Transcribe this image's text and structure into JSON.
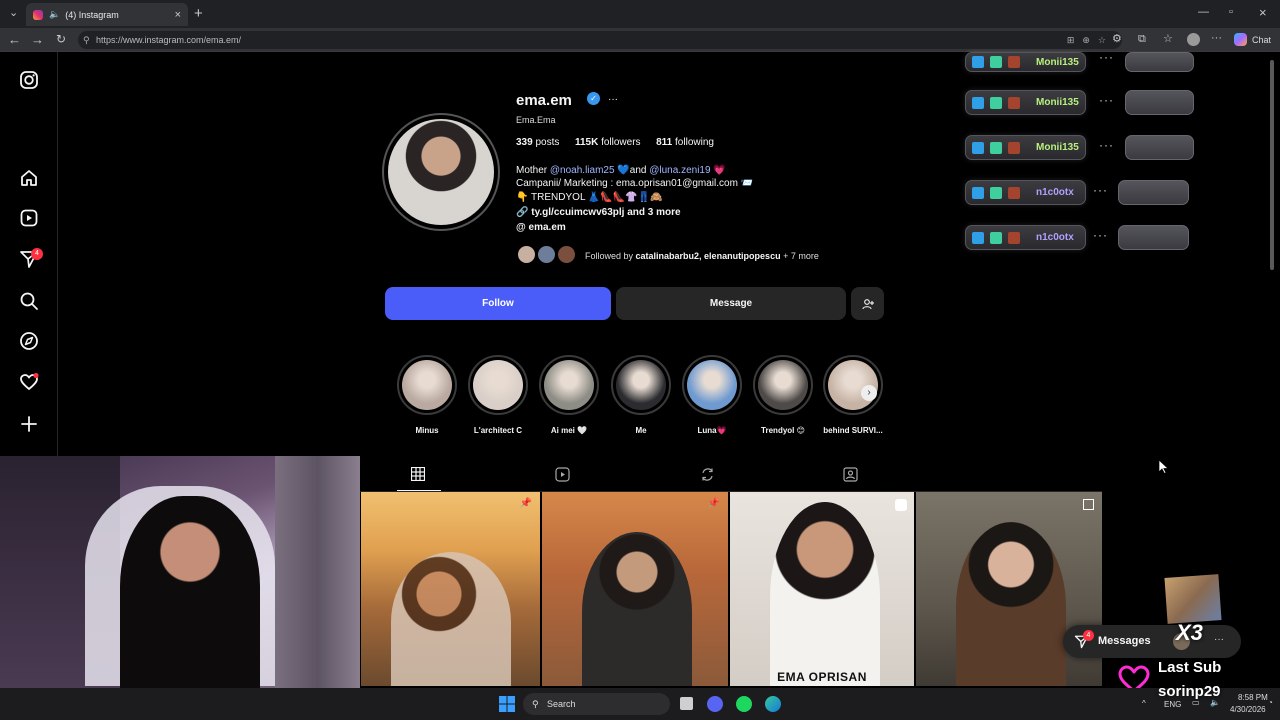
{
  "browser": {
    "tab_title": "(4) Instagram",
    "url": "https://www.instagram.com/ema.em/",
    "chat_label": "Chat"
  },
  "sidebar": {
    "notifications_badge": "4",
    "items": [
      "instagram-logo-icon",
      "home-icon",
      "reels-icon",
      "messages-icon",
      "search-icon",
      "explore-icon",
      "notifications-icon",
      "create-icon"
    ]
  },
  "profile": {
    "username": "ema.em",
    "more": "···",
    "full_name": "Ema.Ema",
    "posts_count": "339",
    "posts_label": "posts",
    "followers_count": "115K",
    "followers_label": "followers",
    "following_count": "811",
    "following_label": "following",
    "bio_line1_prefix": "Mother ",
    "bio_mention1": "@noah.liam25",
    "bio_and": " 💙and ",
    "bio_mention2": "@luna.zeni19",
    "bio_heart": " 💗",
    "bio_line2": "Campanii/ Marketing : ema.oprisan01@gmail.com 📨",
    "bio_line3": "👇 TRENDYOL 👗👠👠👚👖🙈",
    "link": "ty.gl/ccuimcwv63plj and 3 more",
    "threads": "ema.em",
    "followed_by_prefix": "Followed by ",
    "followed_by_names": "catalinabarbu2, elenanutipopescu",
    "followed_by_more": " + 7 more"
  },
  "actions": {
    "follow": "Follow",
    "message": "Message"
  },
  "highlights": [
    {
      "label": "Minus",
      "color": "#b9a9a0"
    },
    {
      "label": "L'architect C",
      "color": "#d9cfc8"
    },
    {
      "label": "Ai mei 🤍",
      "color": "#8d8d86"
    },
    {
      "label": "Me",
      "color": "#2c2c30"
    },
    {
      "label": "Luna💗",
      "color": "#6f9ad0"
    },
    {
      "label": "Trendyol 😊",
      "color": "#4e4a48"
    },
    {
      "label": "behind SURVI...",
      "color": "#c6b3a5"
    }
  ],
  "posts": [
    {
      "caption": "",
      "pinned": true
    },
    {
      "caption": "",
      "pinned": true
    },
    {
      "caption": "EMA OPRISAN",
      "pinned": false
    },
    {
      "caption": "",
      "pinned": false
    }
  ],
  "overlay": {
    "sub_names": [
      "Monii135",
      "Monii135",
      "Monii135",
      "n1c0otx",
      "n1c0otx"
    ],
    "messages_badge": "4",
    "messages_label": "Messages",
    "multiplier": "X3",
    "last_sub_label": "Last Sub",
    "last_sub_name": "sorinp29"
  },
  "taskbar": {
    "search_label": "Search",
    "lang": "ENG",
    "time": "8:58 PM",
    "date": "4/30/2026"
  }
}
